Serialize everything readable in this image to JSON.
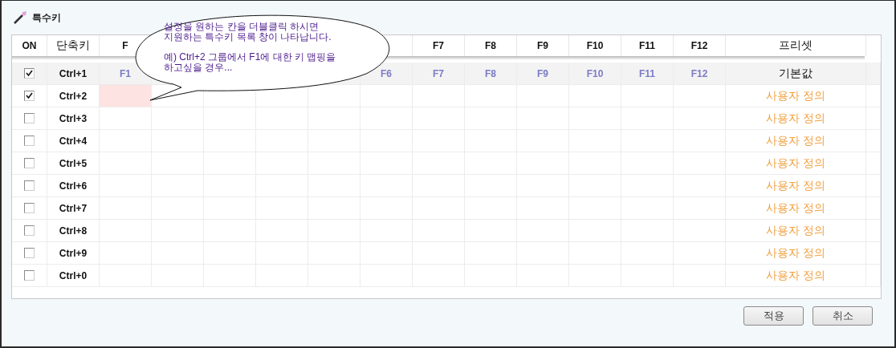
{
  "window": {
    "title": "특수키"
  },
  "columns": [
    {
      "label": "ON"
    },
    {
      "label": "단축키"
    },
    {
      "label": "F"
    },
    {},
    {},
    {},
    {},
    {},
    {
      "label": "F7"
    },
    {
      "label": "F8"
    },
    {
      "label": "F9"
    },
    {
      "label": "F10"
    },
    {
      "label": "F11"
    },
    {
      "label": "F12"
    },
    {
      "label": "프리셋"
    }
  ],
  "rows": [
    {
      "checked": true,
      "shortcut": "Ctrl+1",
      "kind": "default",
      "preset": "기본값",
      "cells": [
        {
          "text": "F1"
        },
        {
          "selected": false
        },
        {},
        {},
        {
          "selected": false
        },
        {
          "text": "F6"
        },
        {
          "text": "F7"
        },
        {
          "text": "F8"
        },
        {
          "text": "F9"
        },
        {
          "text": "F10"
        },
        {
          "text": "F11"
        },
        {
          "text": "F12"
        }
      ]
    },
    {
      "checked": true,
      "shortcut": "Ctrl+2",
      "kind": "custom",
      "preset": "사용자 정의",
      "cells": [
        {
          "selected": true
        },
        {
          "selected": false
        },
        {
          "selected": false
        },
        {
          "selected": false
        },
        {
          "selected": false
        },
        {
          "selected": false
        },
        {
          "selected": false
        },
        {
          "selected": false
        },
        {
          "selected": false
        },
        {
          "selected": false
        },
        {
          "selected": false
        },
        {
          "selected": false
        }
      ]
    },
    {
      "checked": false,
      "shortcut": "Ctrl+3",
      "kind": "custom",
      "preset": "사용자 정의"
    },
    {
      "checked": false,
      "shortcut": "Ctrl+4",
      "kind": "custom",
      "preset": "사용자 정의"
    },
    {
      "checked": false,
      "shortcut": "Ctrl+5",
      "kind": "custom",
      "preset": "사용자 정의"
    },
    {
      "checked": false,
      "shortcut": "Ctrl+6",
      "kind": "custom",
      "preset": "사용자 정의"
    },
    {
      "checked": false,
      "shortcut": "Ctrl+7",
      "kind": "custom",
      "preset": "사용자 정의"
    },
    {
      "checked": false,
      "shortcut": "Ctrl+8",
      "kind": "custom",
      "preset": "사용자 정의"
    },
    {
      "checked": false,
      "shortcut": "Ctrl+9",
      "kind": "custom",
      "preset": "사용자 정의"
    },
    {
      "checked": false,
      "shortcut": "Ctrl+0",
      "kind": "custom",
      "preset": "사용자 정의"
    }
  ],
  "callout": {
    "paragraphs": [
      [
        "설정을 원하는 칸을 더블클릭 하시면",
        "지원하는 특수키 목록 창이 나타납니다."
      ],
      [
        "예) Ctrl+2 그룹에서 F1에 대한 키 맵핑을",
        "하고싶을 경우..."
      ]
    ]
  },
  "buttons": [
    {
      "label": "적용"
    },
    {
      "label": "취소"
    }
  ]
}
